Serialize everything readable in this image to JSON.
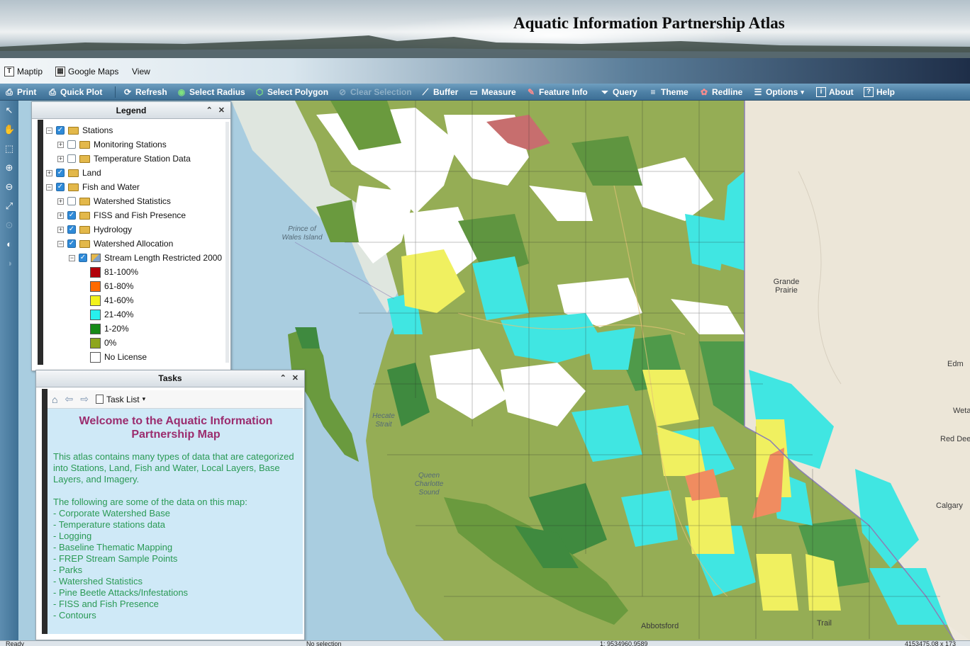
{
  "header": {
    "title": "Aquatic Information Partnership Atlas"
  },
  "menubar": {
    "items": [
      {
        "label": "Maptip",
        "icon": "maptip-icon"
      },
      {
        "label": "Google Maps",
        "icon": "google-maps-icon"
      },
      {
        "label": "View"
      }
    ]
  },
  "toolbar": {
    "print": "Print",
    "quick_plot": "Quick Plot",
    "refresh": "Refresh",
    "select_radius": "Select Radius",
    "select_polygon": "Select Polygon",
    "clear_selection": "Clear Selection",
    "buffer": "Buffer",
    "measure": "Measure",
    "feature_info": "Feature Info",
    "query": "Query",
    "theme": "Theme",
    "redline": "Redline",
    "options": "Options",
    "about": "About",
    "help": "Help"
  },
  "legend": {
    "title": "Legend",
    "rows": [
      {
        "label": "Stations",
        "checked": true
      },
      {
        "label": "Monitoring Stations",
        "checked": false
      },
      {
        "label": "Temperature Station Data",
        "checked": false
      },
      {
        "label": "Land",
        "checked": true
      },
      {
        "label": "Fish and Water",
        "checked": true
      },
      {
        "label": "Watershed Statistics",
        "checked": false
      },
      {
        "label": "FISS and Fish Presence",
        "checked": true
      },
      {
        "label": "Hydrology",
        "checked": true
      },
      {
        "label": "Watershed Allocation",
        "checked": true
      },
      {
        "label": "Stream Length Restricted 2000",
        "checked": true
      }
    ],
    "classes": [
      {
        "label": "81-100%",
        "color": "#b3000a"
      },
      {
        "label": "61-80%",
        "color": "#ff6a00"
      },
      {
        "label": "41-60%",
        "color": "#f2f21a"
      },
      {
        "label": "21-40%",
        "color": "#28f0ee"
      },
      {
        "label": "1-20%",
        "color": "#178a17"
      },
      {
        "label": "0%",
        "color": "#8ea61e"
      },
      {
        "label": "No License",
        "color": "#ffffff"
      }
    ]
  },
  "tasks": {
    "title": "Tasks",
    "task_list_label": "Task List",
    "welcome": "Welcome to the Aquatic Information Partnership Map",
    "intro": "This atlas contains many types of data that are categorized into Stations, Land, Fish and Water, Local Layers, Base Layers, and Imagery.",
    "list_heading": "The following are some of the data on this map:",
    "items": [
      "- Corporate Watershed Base",
      "- Temperature stations data",
      "- Logging",
      "- Baseline Thematic Mapping",
      "- FREP Stream Sample Points",
      "- Parks",
      "- Watershed Statistics",
      "- Pine Beetle Attacks/Infestations",
      "- FISS and Fish Presence",
      "- Contours"
    ]
  },
  "map_labels": {
    "prince_of_wales": "Prince of Wales Island",
    "hecate": "Hecate Strait",
    "queen_charlotte": "Queen Charlotte Sound",
    "grande_prairie": "Grande Prairie",
    "edmonton": "Edm",
    "wetaskiwin": "Weta",
    "red_deer": "Red Dee",
    "calgary": "Calgary",
    "abbotsford": "Abbotsford",
    "trail": "Trail"
  },
  "status": {
    "left": "Ready",
    "selection": "No selection",
    "scale": "1: 9534960.9589",
    "coords": "4153475.08 x 173"
  },
  "colors": {
    "accent": "#4f82a7",
    "welcome": "#9b2c6e",
    "body_text": "#2a9a55"
  }
}
